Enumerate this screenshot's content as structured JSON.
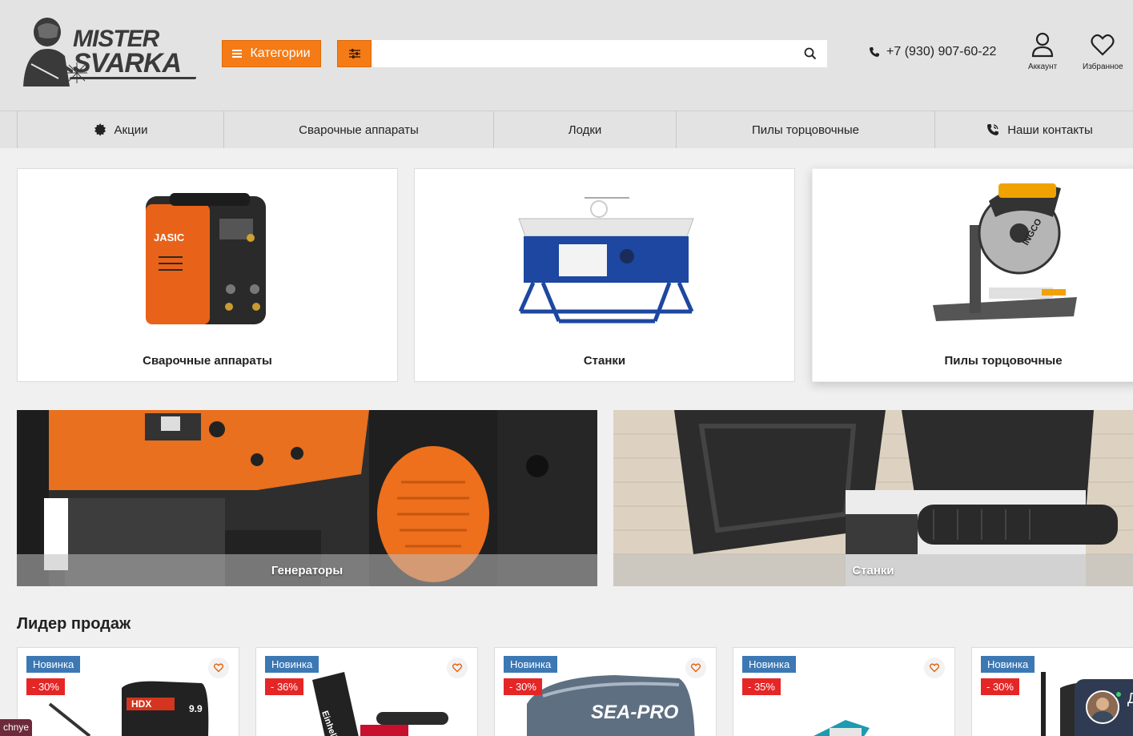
{
  "header": {
    "logo": {
      "line1": "MISTER",
      "line2": "SVARKA"
    },
    "categories_button": "Категории",
    "search": {
      "value": "",
      "placeholder": ""
    },
    "phone": "+7 (930) 907-60-22",
    "account_label": "Аккаунт",
    "favorites_label": "Избранное"
  },
  "nav": {
    "items": [
      {
        "label": "Акции",
        "icon": "badge-star-icon"
      },
      {
        "label": "Сварочные аппараты"
      },
      {
        "label": "Лодки"
      },
      {
        "label": "Пилы торцовочные"
      },
      {
        "label": "Наши контакты",
        "icon": "phone-contact-icon"
      }
    ]
  },
  "categories": [
    {
      "label": "Сварочные аппараты",
      "image": "welding-machine"
    },
    {
      "label": "Станки",
      "image": "table-saw"
    },
    {
      "label": "Пилы торцовочные",
      "image": "miter-saw"
    }
  ],
  "banners": [
    {
      "label": "Генераторы",
      "image": "generator"
    },
    {
      "label": "Станки",
      "image": "planer-machine"
    }
  ],
  "bestsellers": {
    "title": "Лидер продаж",
    "products": [
      {
        "badge_new": "Новинка",
        "discount": "- 30%",
        "image": "outboard-motor-hdx"
      },
      {
        "badge_new": "Новинка",
        "discount": "- 36%",
        "image": "einhell-trimmer"
      },
      {
        "badge_new": "Новинка",
        "discount": "- 30%",
        "image": "outboard-motor-seapro"
      },
      {
        "badge_new": "Новинка",
        "discount": "- 35%",
        "image": "makita-tool"
      },
      {
        "badge_new": "Новинка",
        "discount": "- 30%",
        "image": "outboard-motor"
      }
    ]
  },
  "chat": {
    "letter": "Д"
  },
  "bottom_tag": "chnye",
  "colors": {
    "accent": "#f47b16",
    "badge_new": "#3c78b4",
    "badge_sale": "#e52626",
    "header_bg": "#e3e3e3"
  }
}
